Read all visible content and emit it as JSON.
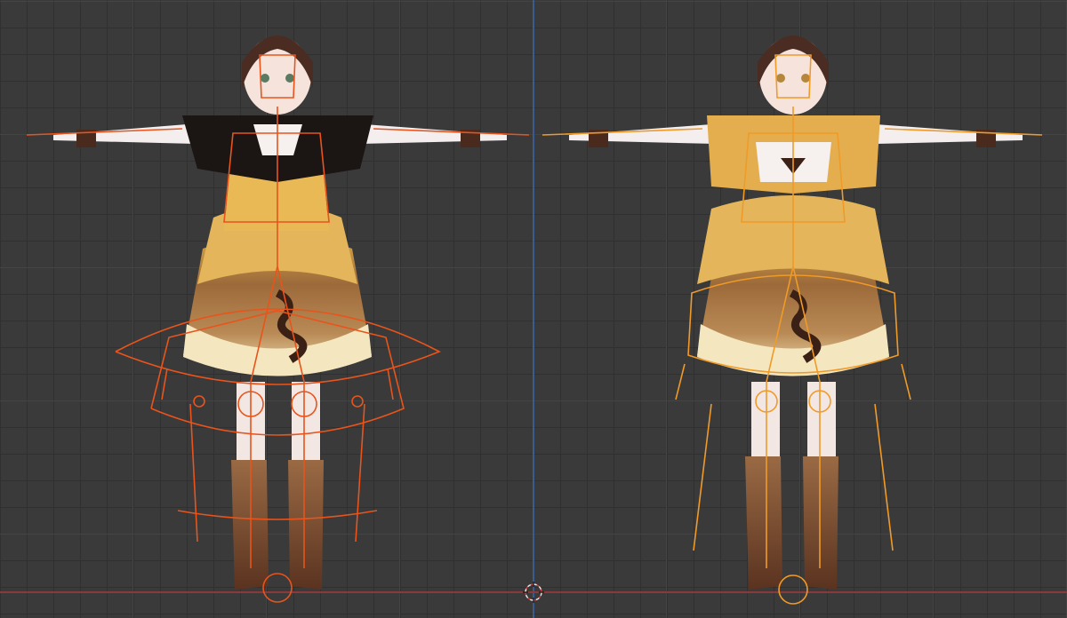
{
  "viewport": {
    "colors": {
      "bone_left": "#e8541c",
      "bone_right": "#f09a28",
      "background": "#3a3a3a",
      "axis_y": "#3b5a8f",
      "axis_x": "#8a3a3a"
    }
  },
  "models": [
    {
      "side": "left",
      "armature_mode": "edit-bones-selected",
      "outfit": "black-and-gold bolero over layered cream/brown dress"
    },
    {
      "side": "right",
      "armature_mode": "pose-bones-selected",
      "outfit": "gold bolero over layered cream/brown dress"
    }
  ],
  "icons": {
    "cursor": "3d-cursor-icon",
    "origin": "origin-icon"
  }
}
